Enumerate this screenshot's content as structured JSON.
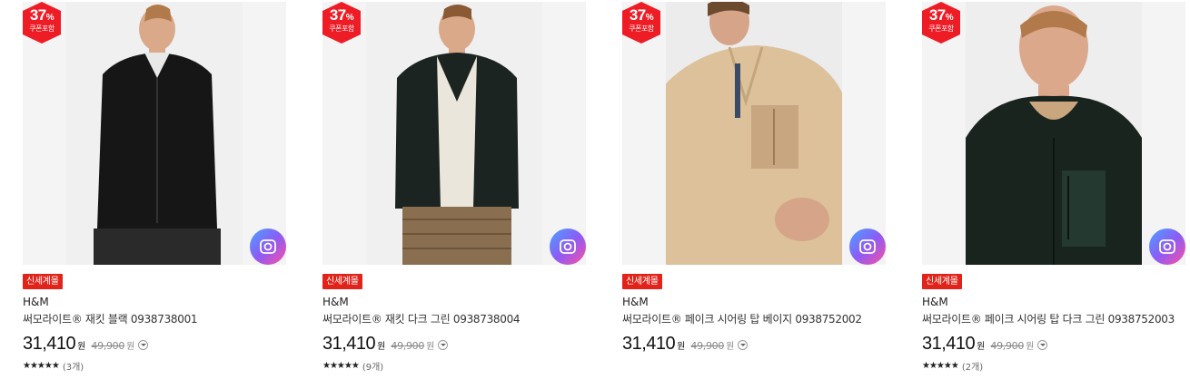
{
  "products": [
    {
      "discount_percent": "37",
      "discount_suffix": "%",
      "coupon_label": "쿠폰포함",
      "badge": "신세계몰",
      "brand": "H&M",
      "name": "써모라이트® 재킷 블랙 0938738001",
      "price": "31,410",
      "currency": "원",
      "original_price": "49,900",
      "original_currency": "원",
      "rating_stars": "★★★★★",
      "review_count": "(3개)",
      "garment_color": "#161616"
    },
    {
      "discount_percent": "37",
      "discount_suffix": "%",
      "coupon_label": "쿠폰포함",
      "badge": "신세계몰",
      "brand": "H&M",
      "name": "써모라이트® 재킷 다크 그린 0938738004",
      "price": "31,410",
      "currency": "원",
      "original_price": "49,900",
      "original_currency": "원",
      "rating_stars": "★★★★★",
      "review_count": "(9개)",
      "garment_color": "#1b2420"
    },
    {
      "discount_percent": "37",
      "discount_suffix": "%",
      "coupon_label": "쿠폰포함",
      "badge": "신세계몰",
      "brand": "H&M",
      "name": "써모라이트® 페이크 시어링 탑 베이지 0938752002",
      "price": "31,410",
      "currency": "원",
      "original_price": "49,900",
      "original_currency": "원",
      "rating_stars": "",
      "review_count": "",
      "garment_color": "#dcc19a"
    },
    {
      "discount_percent": "37",
      "discount_suffix": "%",
      "coupon_label": "쿠폰포함",
      "badge": "신세계몰",
      "brand": "H&M",
      "name": "써모라이트® 페이크 시어링 탑 다크 그린 0938752003",
      "price": "31,410",
      "currency": "원",
      "original_price": "49,900",
      "original_currency": "원",
      "rating_stars": "★★★★★",
      "review_count": "(2개)",
      "garment_color": "#1a241f"
    }
  ],
  "colors": {
    "badge_red": "#e2231a",
    "discount_red": "#ee1c25"
  },
  "icons": {
    "lens": "camera-search-icon",
    "info": "chevron-down-circle-icon"
  }
}
